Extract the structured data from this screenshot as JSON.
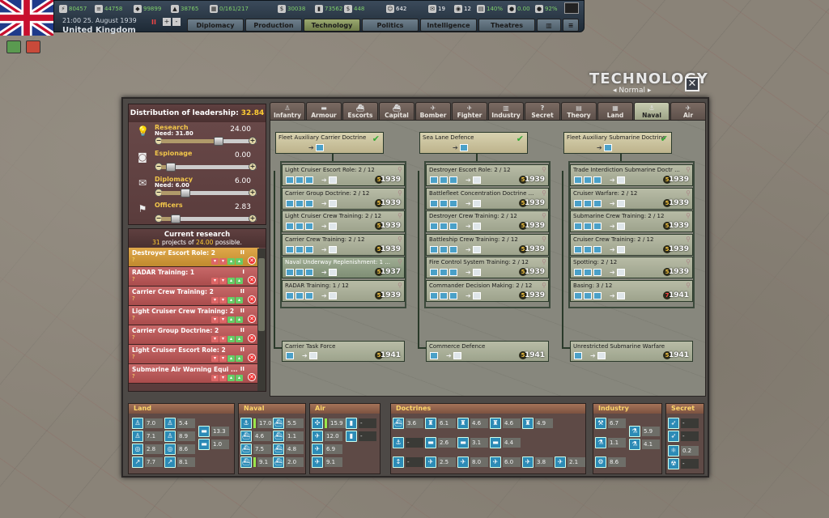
{
  "topbar": {
    "resources": [
      {
        "icon": "energy-icon",
        "value": "80457"
      },
      {
        "icon": "metal-icon",
        "value": "44758"
      },
      {
        "icon": "rare-materials-icon",
        "value": "99899"
      },
      {
        "icon": "oil-icon",
        "value": "38765"
      },
      {
        "icon": "supplies-icon",
        "value": "0/161/217"
      },
      {
        "icon": "money-icon",
        "value": "30038"
      },
      {
        "icon": "fuel-icon",
        "value": "73562"
      },
      {
        "icon": "dollar-icon",
        "value": "448"
      },
      {
        "icon": "manpower-icon",
        "value": "642"
      },
      {
        "icon": "diplomats-icon",
        "value": "19"
      },
      {
        "icon": "spies-icon",
        "value": "12"
      },
      {
        "icon": "dissent-icon",
        "value": "140%"
      },
      {
        "icon": "nu-icon",
        "value": "0.00"
      },
      {
        "icon": "unity-icon",
        "value": "92%"
      }
    ],
    "date": "21:00 25. August 1939",
    "nation": "United Kingdom",
    "buttons": [
      "Diplomacy",
      "Production",
      "Technology",
      "Politics",
      "Intelligence",
      "Theatres"
    ]
  },
  "header": {
    "title": "TECHNOLOGY",
    "mode": "Normal"
  },
  "distribution": {
    "label": "Distribution of leadership:",
    "value": "32.84",
    "rows": [
      {
        "label": "Research",
        "need": "Need: 31.80",
        "value": "24.00",
        "level": 0.6
      },
      {
        "label": "Espionage",
        "need": "",
        "value": "0.00",
        "level": 0.1
      },
      {
        "label": "Diplomacy",
        "need": "Need: 6.00",
        "value": "6.00",
        "level": 0.25
      },
      {
        "label": "Officers",
        "need": "",
        "value": "2.83",
        "level": 0.15
      }
    ]
  },
  "current_research": {
    "title": "Current research",
    "count": "31",
    "mid": " projects of ",
    "possible": "24.00",
    "suffix": " possible.",
    "items": [
      {
        "name": "Destroyer Escort Role: 2",
        "level": "II",
        "q": "?"
      },
      {
        "name": "RADAR Training: 1",
        "level": "I",
        "q": "?"
      },
      {
        "name": "Carrier Crew Training: 2",
        "level": "II",
        "q": "?"
      },
      {
        "name": "Light Cruiser Crew Training: 2",
        "level": "II",
        "q": "?"
      },
      {
        "name": "Carrier Group Doctrine: 2",
        "level": "II",
        "q": "?"
      },
      {
        "name": "Light Cruiser Escort Role: 2",
        "level": "II",
        "q": "?"
      },
      {
        "name": "Submarine Air Warning Equi ...",
        "level": "II",
        "q": "?"
      }
    ]
  },
  "tabs": [
    "Infantry",
    "Armour",
    "Escorts",
    "Capital",
    "Bomber",
    "Fighter",
    "Industry",
    "Secret",
    "Theory",
    "Land",
    "Naval",
    "Air"
  ],
  "tree": {
    "columns": [
      {
        "doctrine": "Fleet Auxiliary Carrier Doctrine",
        "items": [
          {
            "name": "Light Cruiser Escort Role: 2 / 12",
            "year": "1939"
          },
          {
            "name": "Carrier Group Doctrine: 2 / 12",
            "year": "1939"
          },
          {
            "name": "Light Cruiser Crew Training: 2 / 12",
            "year": "1939"
          },
          {
            "name": "Carrier Crew Training: 2 / 12",
            "year": "1939"
          },
          {
            "name": "Naval Underway Replenishment: 1 ...",
            "year": "1937"
          },
          {
            "name": "RADAR Training: 1 / 12",
            "year": "1939"
          }
        ],
        "final": {
          "name": "Carrier Task Force",
          "year": "1941"
        }
      },
      {
        "doctrine": "Sea Lane Defence",
        "items": [
          {
            "name": "Destroyer Escort Role: 2 / 12",
            "year": "1939"
          },
          {
            "name": "Battlefleet Concentration Doctrine ...",
            "year": "1939"
          },
          {
            "name": "Destroyer Crew Training: 2 / 12",
            "year": "1939"
          },
          {
            "name": "Battleship Crew Training: 2 / 12",
            "year": "1939"
          },
          {
            "name": "Fire Control System Training: 2 / 12",
            "year": "1939"
          },
          {
            "name": "Commander Decision Making: 2 / 12",
            "year": "1939"
          }
        ],
        "final": {
          "name": "Commerce Defence",
          "year": "1941"
        }
      },
      {
        "doctrine": "Fleet Auxiliary Submarine Doctrine",
        "items": [
          {
            "name": "Trade Interdiction Submarine Doctr ...",
            "year": "1939"
          },
          {
            "name": "Cruiser Warfare: 2 / 12",
            "year": "1939"
          },
          {
            "name": "Submarine Crew Training: 2 / 12",
            "year": "1939"
          },
          {
            "name": "Cruiser Crew Training: 2 / 12",
            "year": "1939"
          },
          {
            "name": "Spotting: 2 / 12",
            "year": "1939"
          },
          {
            "name": "Basing: 3 / 12",
            "year": "1941"
          }
        ],
        "final": {
          "name": "Unrestricted Submarine Warfare",
          "year": "1941"
        }
      }
    ]
  },
  "summary": {
    "land": {
      "label": "Land",
      "values": [
        "7.0",
        "5.4",
        "7.1",
        "8.9",
        "2.8",
        "8.6",
        "7.7",
        "8.1",
        "13.3",
        "1.0"
      ]
    },
    "naval": {
      "label": "Naval",
      "values": [
        "17.0",
        "5.5",
        "4.6",
        "1.1",
        "7.5",
        "4.8",
        "9.1",
        "2.0"
      ]
    },
    "air": {
      "label": "Air",
      "values": [
        "15.9",
        "-",
        "12.0",
        "-",
        "6.9",
        "9.1"
      ]
    },
    "doctrines": {
      "label": "Doctrines",
      "values": [
        "3.6",
        "6.1",
        "4.6",
        "4.6",
        "4.9",
        "-",
        "2.6",
        "3.1",
        "4.4",
        "-",
        "2.5",
        "8.0",
        "6.0",
        "3.8",
        "2.1"
      ]
    },
    "industry": {
      "label": "Industry",
      "values": [
        "6.7",
        "5.9",
        "1.1",
        "4.1",
        "8.6"
      ]
    },
    "secret": {
      "label": "Secret",
      "values": [
        "-",
        "-",
        "0.2",
        "-"
      ]
    }
  }
}
